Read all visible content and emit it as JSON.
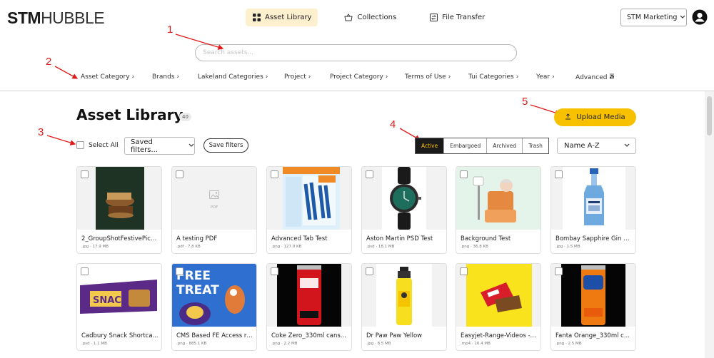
{
  "header": {
    "logo_bold": "STM",
    "logo_light": "HUBBLE",
    "nav": [
      {
        "label": "Asset Library",
        "icon": "grid-icon",
        "active": true
      },
      {
        "label": "Collections",
        "icon": "basket-icon",
        "active": false
      },
      {
        "label": "File Transfer",
        "icon": "transfer-icon",
        "active": false
      }
    ],
    "account": "STM Marketing",
    "search_placeholder": "Search assets..."
  },
  "filters": [
    "Asset Category",
    "Brands",
    "Lakeland Categories",
    "Project",
    "Project Category",
    "Terms of Use",
    "Tui Categories",
    "Year",
    "Advanced"
  ],
  "annotations": [
    "1",
    "2",
    "3",
    "4",
    "5"
  ],
  "page": {
    "title": "Asset Library",
    "count": "40",
    "upload_label": "Upload Media",
    "select_all_label": "Select All",
    "saved_filters_label": "Saved filters...",
    "save_filters_label": "Save filters",
    "status_tabs": [
      "Active",
      "Embargoed",
      "Archived",
      "Trash"
    ],
    "active_status": "Active",
    "sort_label": "Name A-Z"
  },
  "assets": [
    {
      "name": "2_GroupShotFestivePick...",
      "meta": ".jpg · 17.9 MB",
      "thumb": "cake"
    },
    {
      "name": "A testing PDF",
      "meta": ".pdf · 7.8 KB",
      "thumb": "pdf",
      "thumb_label": "PDF"
    },
    {
      "name": "Advanced Tab Test",
      "meta": ".png · 127.0 KB",
      "thumb": "poster"
    },
    {
      "name": "Aston Martin PSD Test",
      "meta": ".psd · 18.1 MB",
      "thumb": "watch"
    },
    {
      "name": "Background Test",
      "meta": ".png · 36.8 KB",
      "thumb": "illustration"
    },
    {
      "name": "Bombay Sapphire Gin 5...",
      "meta": ".jpg · 1.5 MB",
      "thumb": "gin"
    },
    {
      "name": "Cadbury Snack Shortca...",
      "meta": ".psd · 1.1 MB",
      "thumb": "snack"
    },
    {
      "name": "CMS Based FE Access re...",
      "meta": ".png · 885.1 KB",
      "thumb": "freetreat"
    },
    {
      "name": "Coke Zero_330ml cans...",
      "meta": ".png · 2.2 MB",
      "thumb": "coke"
    },
    {
      "name": "Dr Paw Paw Yellow",
      "meta": ".jpg · 8.5 MB",
      "thumb": "pawpaw"
    },
    {
      "name": "Easyjet-Range-Videos -...",
      "meta": ".mp4 · 16.4 MB",
      "thumb": "kitkat"
    },
    {
      "name": "Fanta Orange_330ml c...",
      "meta": ".png · 2.5 MB",
      "thumb": "fanta"
    }
  ],
  "colors": {
    "accent": "#f7c100",
    "annotation": "#e11b1b"
  }
}
